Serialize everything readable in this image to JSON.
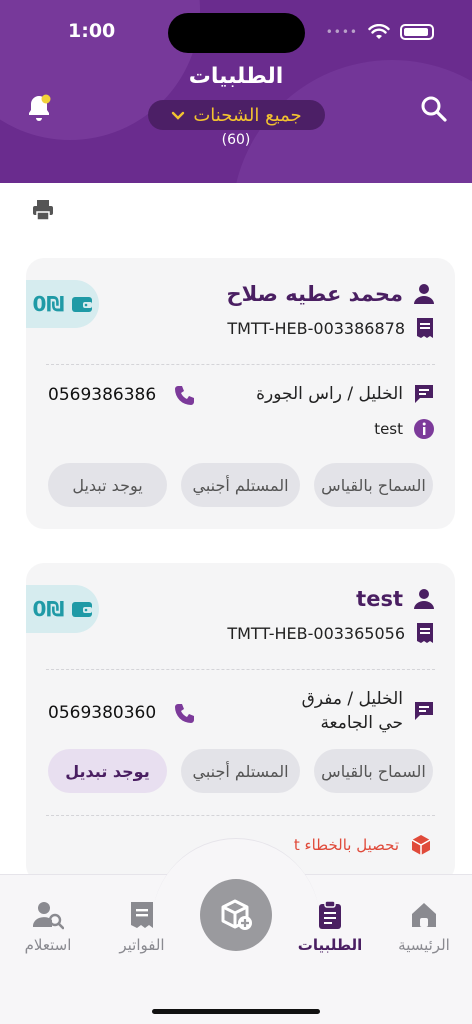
{
  "status_bar": {
    "time": "1:00",
    "dots": "••••"
  },
  "header": {
    "title": "الطلبيات",
    "filter_label": "جميع الشحنات",
    "count": "(60)"
  },
  "orders": [
    {
      "name": "محمد عطيه صلاح",
      "code": "TMTT-HEB-003386878",
      "address": "الخليل / راس الجورة",
      "phone": "0569386386",
      "note": "test",
      "wallet": "0₪",
      "chips": [
        "السماح بالقياس",
        "المستلم أجنبي",
        "يوجد تبديل"
      ]
    },
    {
      "name": "test",
      "code": "TMTT-HEB-003365056",
      "address": "الخليل / مفرق حي الجامعة",
      "phone": "0569380360",
      "wallet": "0₪",
      "chips": [
        "السماح بالقياس",
        "المستلم أجنبي",
        "يوجد تبديل"
      ],
      "error_text": "تحصيل بالخطاء t"
    }
  ],
  "bottom_nav": {
    "home": "الرئيسية",
    "orders": "الطلبيات",
    "invoices": "الفواتير",
    "inquiry": "استعلام"
  },
  "colors": {
    "brand": "#6a2c8e",
    "accent": "#f2c230",
    "teal": "#1f9aa6",
    "error": "#e04a3a"
  }
}
